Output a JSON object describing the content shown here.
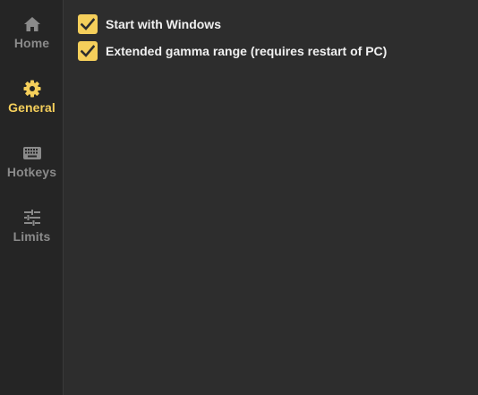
{
  "sidebar": {
    "items": [
      {
        "label": "Home",
        "icon": "home-icon",
        "active": false
      },
      {
        "label": "General",
        "icon": "gear-icon",
        "active": true
      },
      {
        "label": "Hotkeys",
        "icon": "keyboard-icon",
        "active": false
      },
      {
        "label": "Limits",
        "icon": "sliders-icon",
        "active": false
      }
    ]
  },
  "general": {
    "options": [
      {
        "label": "Start with Windows",
        "checked": true
      },
      {
        "label": "Extended gamma range (requires restart of PC)",
        "checked": true
      }
    ]
  },
  "colors": {
    "accent": "#f5cf5b",
    "inactive": "#8a8a8a",
    "background": "#2d2d2d",
    "sidebar": "#252525",
    "text": "#f0f0f0"
  }
}
